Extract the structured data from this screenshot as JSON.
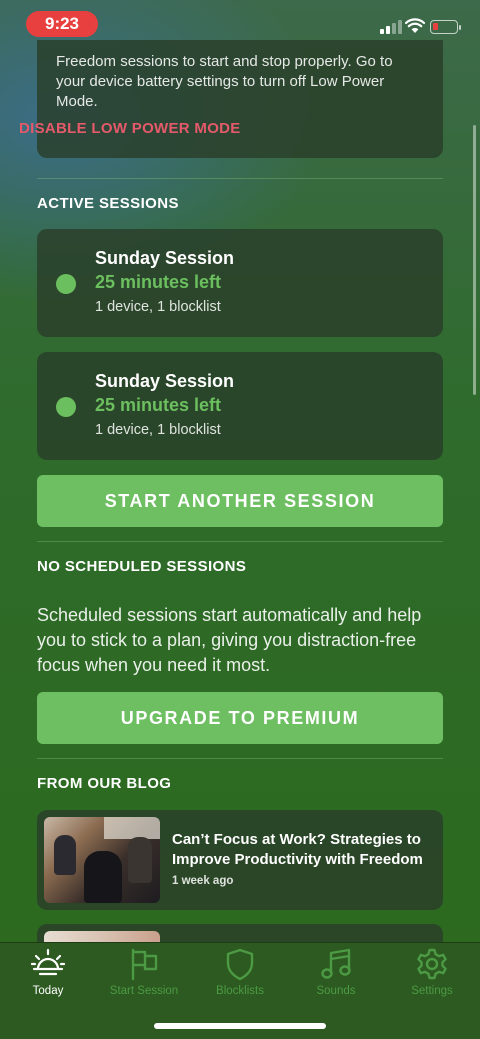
{
  "status_bar": {
    "time": "9:23"
  },
  "warning": {
    "text": "Freedom sessions to start and stop properly. Go to your device battery settings to turn off Low Power Mode.",
    "link": "DISABLE LOW POWER MODE"
  },
  "active_sessions": {
    "title": "ACTIVE SESSIONS",
    "items": [
      {
        "name": "Sunday Session",
        "time_left": "25 minutes left",
        "meta": "1 device, 1 blocklist"
      },
      {
        "name": "Sunday Session",
        "time_left": "25 minutes left",
        "meta": "1 device, 1 blocklist"
      }
    ],
    "button": "START ANOTHER SESSION"
  },
  "scheduled": {
    "title": "NO SCHEDULED SESSIONS",
    "text": "Scheduled sessions start automatically and help you to stick to a plan, giving you distraction-free focus when you need it most.",
    "button": "UPGRADE TO PREMIUM"
  },
  "blog": {
    "title": "FROM OUR BLOG",
    "posts": [
      {
        "title": "Can’t Focus at Work? Strategies to Improve Productivity with Freedom",
        "date": "1 week ago"
      }
    ]
  },
  "tabs": [
    {
      "label": "Today",
      "icon": "sunrise-icon",
      "active": true
    },
    {
      "label": "Start Session",
      "icon": "flag-icon",
      "active": false
    },
    {
      "label": "Blocklists",
      "icon": "shield-icon",
      "active": false
    },
    {
      "label": "Sounds",
      "icon": "music-note-icon",
      "active": false
    },
    {
      "label": "Settings",
      "icon": "gear-icon",
      "active": false
    }
  ],
  "colors": {
    "accent_green": "#6dbf62",
    "warning_link": "#e55a6a",
    "status_time_pill": "#e8403f",
    "tab_inactive": "#4c9a44"
  }
}
